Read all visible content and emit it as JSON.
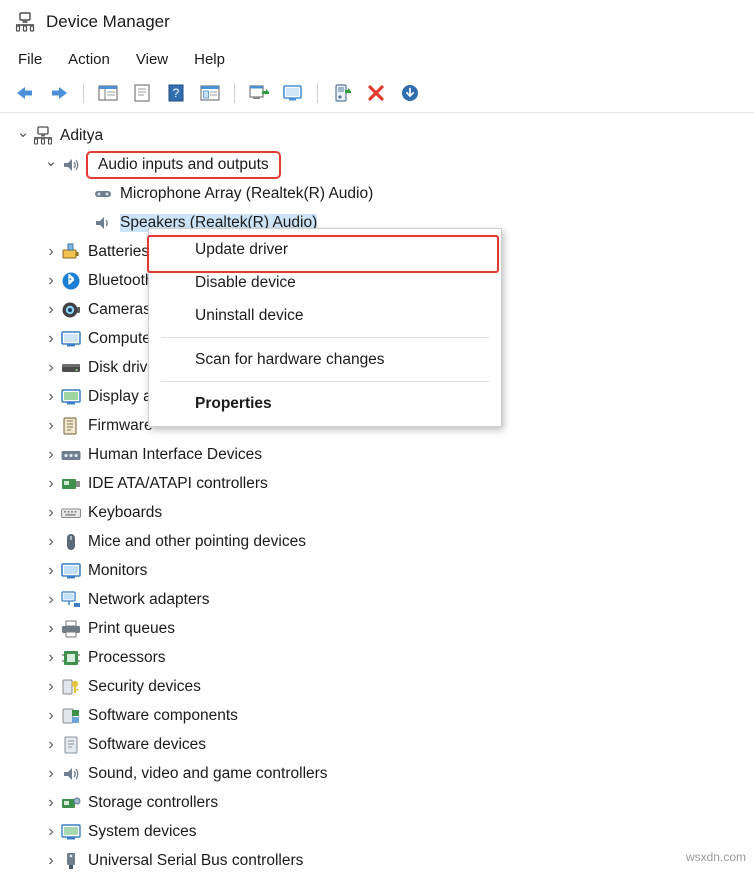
{
  "window": {
    "title": "Device Manager",
    "icon": "device-manager-icon"
  },
  "menu": {
    "items": [
      {
        "label": "File",
        "name": "menu-file"
      },
      {
        "label": "Action",
        "name": "menu-action"
      },
      {
        "label": "View",
        "name": "menu-view"
      },
      {
        "label": "Help",
        "name": "menu-help"
      }
    ]
  },
  "toolbar": {
    "buttons": [
      {
        "name": "back-button",
        "icon": "left-arrow-icon"
      },
      {
        "name": "forward-button",
        "icon": "right-arrow-icon"
      },
      {
        "name": "show-hide-console-tree-button",
        "icon": "tree-pane-icon"
      },
      {
        "name": "properties-button",
        "icon": "properties-icon"
      },
      {
        "name": "help-button",
        "icon": "help-icon"
      },
      {
        "name": "view-devices-button",
        "icon": "devices-view-icon"
      },
      {
        "name": "scan-hardware-changes-button",
        "icon": "scan-hardware-icon"
      },
      {
        "name": "monitor-button",
        "icon": "monitor-icon"
      },
      {
        "name": "update-driver-button",
        "icon": "update-driver-icon"
      },
      {
        "name": "uninstall-device-button",
        "icon": "red-x-icon"
      },
      {
        "name": "disable-device-button",
        "icon": "down-arrow-circle-icon"
      }
    ]
  },
  "tree": {
    "root": {
      "label": "Aditya",
      "name": "tree-root-aditya",
      "expanded": true
    },
    "audio_group": {
      "label": "Audio inputs and outputs",
      "name": "tree-item-audio-inputs-and-outputs",
      "expanded": true,
      "highlighted": true
    },
    "audio_children": [
      {
        "label": "Microphone Array (Realtek(R) Audio)",
        "name": "tree-item-microphone-array"
      },
      {
        "label": "Speakers (Realtek(R) Audio)",
        "name": "tree-item-speakers",
        "selected": true
      }
    ],
    "items": [
      {
        "label": "Batteries",
        "name": "tree-item-batteries",
        "icon": "battery-icon"
      },
      {
        "label": "Bluetooth",
        "name": "tree-item-bluetooth",
        "icon": "bluetooth-icon"
      },
      {
        "label": "Cameras",
        "name": "tree-item-cameras",
        "icon": "camera-icon"
      },
      {
        "label": "Computer",
        "name": "tree-item-computer",
        "icon": "computer-icon"
      },
      {
        "label": "Disk drives",
        "name": "tree-item-disk-drives",
        "icon": "disk-drive-icon"
      },
      {
        "label": "Display adapters",
        "name": "tree-item-display-adapters",
        "icon": "display-adapter-icon"
      },
      {
        "label": "Firmware",
        "name": "tree-item-firmware",
        "icon": "firmware-icon"
      },
      {
        "label": "Human Interface Devices",
        "name": "tree-item-human-interface-devices",
        "icon": "hid-icon"
      },
      {
        "label": "IDE ATA/ATAPI controllers",
        "name": "tree-item-ide-ata-atapi-controllers",
        "icon": "ide-controller-icon"
      },
      {
        "label": "Keyboards",
        "name": "tree-item-keyboards",
        "icon": "keyboard-icon"
      },
      {
        "label": "Mice and other pointing devices",
        "name": "tree-item-mice-and-other-pointing-devices",
        "icon": "mouse-icon"
      },
      {
        "label": "Monitors",
        "name": "tree-item-monitors",
        "icon": "monitor-icon"
      },
      {
        "label": "Network adapters",
        "name": "tree-item-network-adapters",
        "icon": "network-adapter-icon"
      },
      {
        "label": "Print queues",
        "name": "tree-item-print-queues",
        "icon": "printer-icon"
      },
      {
        "label": "Processors",
        "name": "tree-item-processors",
        "icon": "processor-icon"
      },
      {
        "label": "Security devices",
        "name": "tree-item-security-devices",
        "icon": "security-device-icon"
      },
      {
        "label": "Software components",
        "name": "tree-item-software-components",
        "icon": "software-component-icon"
      },
      {
        "label": "Software devices",
        "name": "tree-item-software-devices",
        "icon": "software-device-icon"
      },
      {
        "label": "Sound, video and game controllers",
        "name": "tree-item-sound-video-and-game-controllers",
        "icon": "speaker-icon"
      },
      {
        "label": "Storage controllers",
        "name": "tree-item-storage-controllers",
        "icon": "storage-controller-icon"
      },
      {
        "label": "System devices",
        "name": "tree-item-system-devices",
        "icon": "system-device-icon"
      },
      {
        "label": "Universal Serial Bus controllers",
        "name": "tree-item-universal-serial-bus-controllers",
        "icon": "usb-controller-icon"
      }
    ]
  },
  "context_menu": {
    "items": [
      {
        "label": "Update driver",
        "name": "context-menu-update-driver",
        "highlighted": true
      },
      {
        "label": "Disable device",
        "name": "context-menu-disable-device"
      },
      {
        "label": "Uninstall device",
        "name": "context-menu-uninstall-device"
      },
      {
        "label": "Scan for hardware changes",
        "name": "context-menu-scan-for-hardware-changes"
      },
      {
        "label": "Properties",
        "name": "context-menu-properties",
        "bold": true
      }
    ]
  },
  "watermark": {
    "text": "wsxdn.com"
  },
  "colors": {
    "highlight_red": "#e53935",
    "selection_blue": "#cce4f7",
    "icon_blue": "#4a90d9"
  }
}
